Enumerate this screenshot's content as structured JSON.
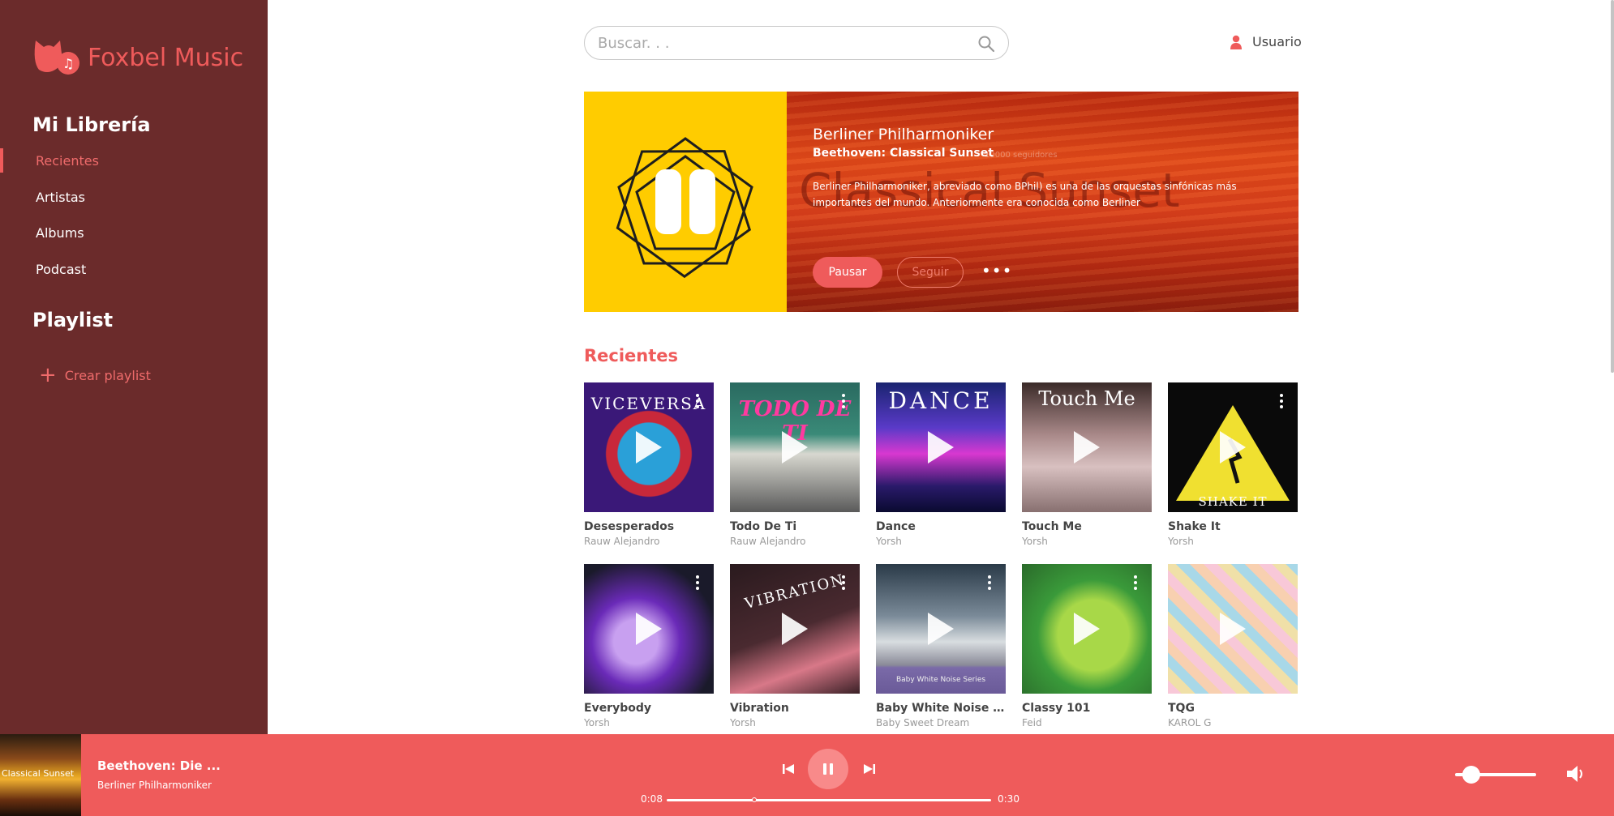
{
  "app": {
    "name": "Foxbel Music"
  },
  "sidebar": {
    "library_title": "Mi Librería",
    "items": [
      {
        "label": "Recientes",
        "active": true
      },
      {
        "label": "Artistas",
        "active": false
      },
      {
        "label": "Albums",
        "active": false
      },
      {
        "label": "Podcast",
        "active": false
      }
    ],
    "playlist_title": "Playlist",
    "create_playlist": "Crear playlist"
  },
  "search": {
    "placeholder": "Buscar. . ."
  },
  "user": {
    "label": "Usuario"
  },
  "hero": {
    "artist": "Berliner Philharmoniker",
    "album": "Beethoven: Classical Sunset",
    "followers": "10000 seguidores",
    "watermark": "Classical Sunset",
    "description": "Berliner Philharmoniker, abreviado como BPhil) es una de las orquestas sinfónicas más importantes del mundo. Anteriormente era conocida como Berliner",
    "pause_label": "Pausar",
    "follow_label": "Seguir",
    "more_label": "•••"
  },
  "recents": {
    "title": "Recientes",
    "items": [
      {
        "title": "Desesperados",
        "artist": "Rauw Alejandro",
        "cover_text": "VICEVERSA"
      },
      {
        "title": "Todo De Ti",
        "artist": "Rauw Alejandro",
        "cover_text": "TODO DE TI"
      },
      {
        "title": "Dance",
        "artist": "Yorsh",
        "cover_text": "DANCE"
      },
      {
        "title": "Touch Me",
        "artist": "Yorsh",
        "cover_text": "Touch Me"
      },
      {
        "title": "Shake It",
        "artist": "Yorsh",
        "cover_text": "SHAKE IT"
      },
      {
        "title": "Everybody",
        "artist": "Yorsh",
        "cover_text": ""
      },
      {
        "title": "Vibration",
        "artist": "Yorsh",
        "cover_text": "VIBRATION"
      },
      {
        "title": "Baby White Noise Series",
        "artist": "Baby Sweet Dream",
        "cover_text": "Baby White Noise Series"
      },
      {
        "title": "Classy 101",
        "artist": "Feid",
        "cover_text": ""
      },
      {
        "title": "TQG",
        "artist": "KAROL G",
        "cover_text": ""
      }
    ]
  },
  "player": {
    "track": "Beethoven: Die ...",
    "artist": "Berliner Philharmoniker",
    "thumb_text": "Classical Sunset",
    "current_time": "0:08",
    "total_time": "0:30",
    "progress": 0.27,
    "volume": 0.2
  },
  "colors": {
    "accent": "#ef5b5b",
    "sidebar": "#6b2b2b",
    "hero_cover": "#ffcc00"
  }
}
